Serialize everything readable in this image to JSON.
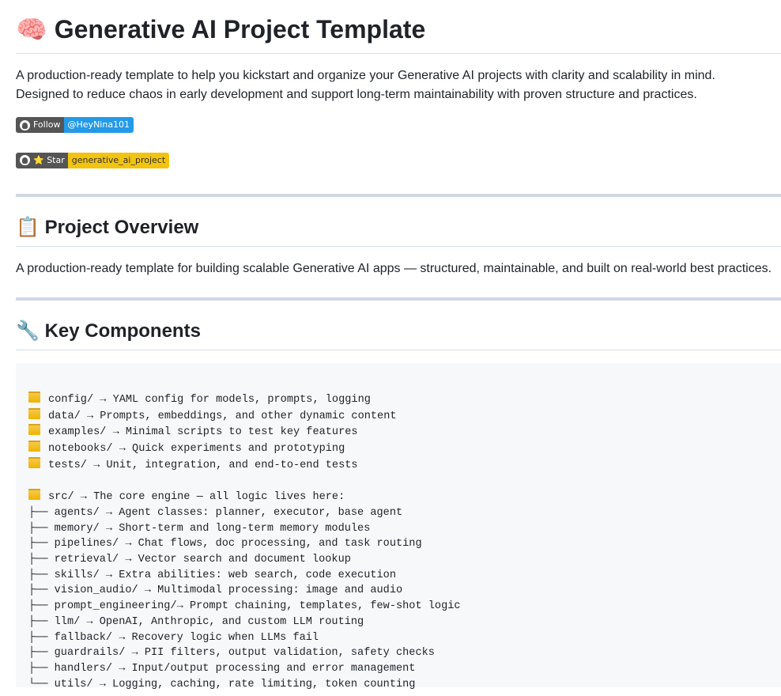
{
  "title": {
    "emoji": "🧠",
    "text": "Generative AI Project Template"
  },
  "intro": [
    "A production-ready template to help you kickstart and organize your Generative AI projects with clarity and scalability in mind.",
    "Designed to reduce chaos in early development and support long-term maintainability with proven structure and practices."
  ],
  "badges": [
    {
      "left": "Follow",
      "right": "@HeyNina101",
      "color": "#239ae6",
      "text_color": "#ffffff"
    },
    {
      "left": "⭐ Star",
      "right": "generative_ai_project",
      "color": "#f2c30f",
      "text_color": "#333333"
    }
  ],
  "overview": {
    "emoji": "📋",
    "heading": "Project Overview",
    "text": "A production-ready template for building scalable Generative AI apps — structured, maintainable, and built on real-world best practices."
  },
  "components": {
    "emoji": "🔧",
    "heading": "Key Components",
    "folders": [
      "config/ → YAML config for models, prompts, logging",
      "data/ → Prompts, embeddings, and other dynamic content",
      "examples/ → Minimal scripts to test key features",
      "notebooks/ → Quick experiments and prototyping",
      "tests/ → Unit, integration, and end-to-end tests"
    ],
    "src": "src/ → The core engine — all logic lives here:",
    "tree": [
      "├── agents/ → Agent classes: planner, executor, base agent",
      "├── memory/ → Short-term and long-term memory modules",
      "├── pipelines/ → Chat flows, doc processing, and task routing",
      "├── retrieval/ → Vector search and document lookup",
      "├── skills/ → Extra abilities: web search, code execution",
      "├── vision_audio/ → Multimodal processing: image and audio",
      "├── prompt_engineering/→ Prompt chaining, templates, few-shot logic",
      "├── llm/ → OpenAI, Anthropic, and custom LLM routing",
      "├── fallback/ → Recovery logic when LLMs fail",
      "├── guardrails/ → PII filters, output validation, safety checks",
      "├── handlers/ → Input/output processing and error management",
      "└── utils/ → Logging, caching, rate limiting, token counting"
    ]
  }
}
